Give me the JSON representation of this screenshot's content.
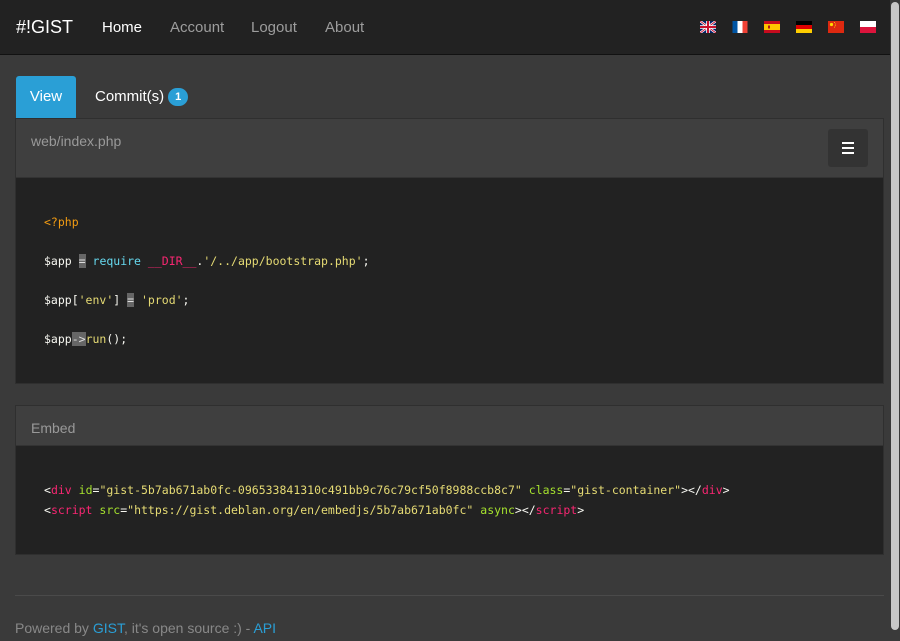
{
  "navbar": {
    "brand": "#!GIST",
    "links": [
      {
        "label": "Home",
        "active": true
      },
      {
        "label": "Account",
        "active": false
      },
      {
        "label": "Logout",
        "active": false
      },
      {
        "label": "About",
        "active": false
      }
    ],
    "languages": [
      "English",
      "French",
      "Spanish",
      "German",
      "Chinese",
      "Polish"
    ]
  },
  "tabs": {
    "view_label": "View",
    "commits_label": "Commit(s)",
    "commits_count": "1"
  },
  "file_panel": {
    "filename": "web/index.php",
    "menu_icon": "hamburger-icon",
    "code": {
      "open_tag": "<?php",
      "l2_var": "$app",
      "l2_eq": "=",
      "l2_require": "require",
      "l2_dir": "__DIR__",
      "l2_dot": ".",
      "l2_str": "'/../app/bootstrap.php'",
      "l2_end": ";",
      "l3_var": "$app[",
      "l3_key": "'env'",
      "l3_close": "]",
      "l3_eq": "=",
      "l3_val": "'prod'",
      "l3_end": ";",
      "l4_var": "$app",
      "l4_arrow": "->",
      "l4_fn": "run",
      "l4_end": "();"
    }
  },
  "embed_panel": {
    "title": "Embed",
    "line1": {
      "open": "<",
      "tag": "div",
      "attr1": "id",
      "val1": "\"gist-5b7ab671ab0fc-096533841310c491bb9c76c79cf50f8988ccb8c7\"",
      "attr2": "class",
      "val2": "\"gist-container\"",
      "close": "></",
      "end_tag": "div",
      "end": ">"
    },
    "line2": {
      "open": "<",
      "tag": "script",
      "attr1": "src",
      "val1": "\"https://gist.deblan.org/en/embedjs/5b7ab671ab0fc\"",
      "attr2": "async",
      "close": "></",
      "end_tag": "script",
      "end": ">"
    }
  },
  "footer": {
    "prefix": "Powered by ",
    "gist_link": "GIST",
    "middle": ", it's open source :) - ",
    "api_link": "API"
  },
  "colors": {
    "accent": "#2a9fd6",
    "navbar_bg": "#222222",
    "page_bg": "#3a3a3a"
  }
}
